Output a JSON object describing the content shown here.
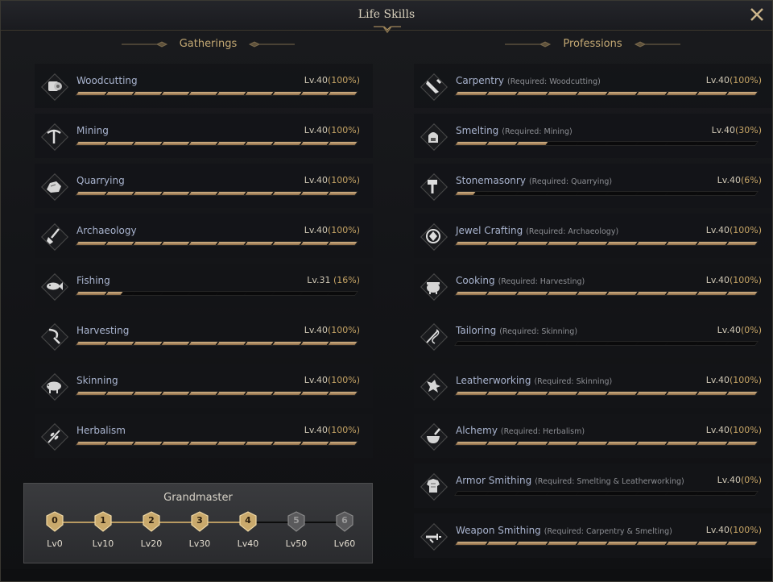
{
  "window": {
    "title": "Life Skills"
  },
  "gatherings": {
    "header": "Gatherings",
    "skills": [
      {
        "name": "Woodcutting",
        "level": "Lv.40",
        "percent": "(100%)",
        "progress": 1.0,
        "icon": "log-icon"
      },
      {
        "name": "Mining",
        "level": "Lv.40",
        "percent": "(100%)",
        "progress": 1.0,
        "icon": "pickaxe-icon"
      },
      {
        "name": "Quarrying",
        "level": "Lv.40",
        "percent": "(100%)",
        "progress": 1.0,
        "icon": "stone-icon"
      },
      {
        "name": "Archaeology",
        "level": "Lv.40",
        "percent": "(100%)",
        "progress": 1.0,
        "icon": "shovel-icon"
      },
      {
        "name": "Fishing",
        "level": "Lv.31",
        "percent": " (16%)",
        "progress": 0.16,
        "icon": "fish-icon"
      },
      {
        "name": "Harvesting",
        "level": "Lv.40",
        "percent": "(100%)",
        "progress": 1.0,
        "icon": "sickle-icon"
      },
      {
        "name": "Skinning",
        "level": "Lv.40",
        "percent": "(100%)",
        "progress": 1.0,
        "icon": "boar-icon"
      },
      {
        "name": "Herbalism",
        "level": "Lv.40",
        "percent": "(100%)",
        "progress": 1.0,
        "icon": "herb-icon"
      }
    ]
  },
  "professions": {
    "header": "Professions",
    "skills": [
      {
        "name": "Carpentry",
        "req": "(Required: Woodcutting)",
        "level": "Lv.40",
        "percent": "(100%)",
        "progress": 1.0,
        "icon": "saw-icon"
      },
      {
        "name": "Smelting",
        "req": "(Required: Mining)",
        "level": "Lv.40",
        "percent": "(30%)",
        "progress": 0.3,
        "icon": "furnace-icon"
      },
      {
        "name": "Stonemasonry",
        "req": "(Required: Quarrying)",
        "level": "Lv.40",
        "percent": "(6%)",
        "progress": 0.06,
        "icon": "hammer-icon"
      },
      {
        "name": "Jewel Crafting",
        "req": "(Required: Archaeology)",
        "level": "Lv.40",
        "percent": "(100%)",
        "progress": 1.0,
        "icon": "gem-icon"
      },
      {
        "name": "Cooking",
        "req": "(Required: Harvesting)",
        "level": "Lv.40",
        "percent": "(100%)",
        "progress": 1.0,
        "icon": "pot-icon"
      },
      {
        "name": "Tailoring",
        "req": "(Required: Skinning)",
        "level": "Lv.40",
        "percent": "(0%)",
        "progress": 0.0,
        "icon": "needle-icon"
      },
      {
        "name": "Leatherworking",
        "req": "(Required: Skinning)",
        "level": "Lv.40",
        "percent": "(100%)",
        "progress": 1.0,
        "icon": "hide-icon"
      },
      {
        "name": "Alchemy",
        "req": "(Required: Herbalism)",
        "level": "Lv.40",
        "percent": "(100%)",
        "progress": 1.0,
        "icon": "mortar-icon"
      },
      {
        "name": "Armor Smithing",
        "req": "(Required: Smelting & Leatherworking)",
        "level": "Lv.40",
        "percent": "(0%)",
        "progress": 0.0,
        "icon": "armor-icon"
      },
      {
        "name": "Weapon Smithing",
        "req": "(Required: Carpentry & Smelting)",
        "level": "Lv.40",
        "percent": "(100%)",
        "progress": 1.0,
        "icon": "sword-icon"
      }
    ]
  },
  "grandmaster": {
    "title": "Grandmaster",
    "tiers": [
      {
        "badge": "0",
        "label": "Lv0",
        "achieved": true
      },
      {
        "badge": "1",
        "label": "Lv10",
        "achieved": true
      },
      {
        "badge": "2",
        "label": "Lv20",
        "achieved": true
      },
      {
        "badge": "3",
        "label": "Lv30",
        "achieved": true
      },
      {
        "badge": "4",
        "label": "Lv40",
        "achieved": true
      },
      {
        "badge": "5",
        "label": "Lv50",
        "achieved": false
      },
      {
        "badge": "6",
        "label": "Lv60",
        "achieved": false
      }
    ]
  },
  "colors": {
    "accent": "#c3a873",
    "bar_fill": "#c9a77c",
    "name": "#a9b4cf"
  }
}
